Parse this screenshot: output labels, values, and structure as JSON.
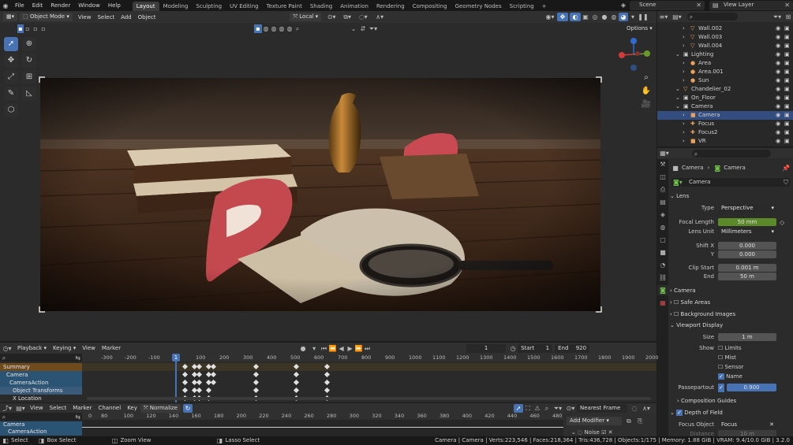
{
  "menu": [
    "File",
    "Edit",
    "Render",
    "Window",
    "Help"
  ],
  "workspaces": [
    "Layout",
    "Modeling",
    "Sculpting",
    "UV Editing",
    "Texture Paint",
    "Shading",
    "Animation",
    "Rendering",
    "Compositing",
    "Geometry Nodes",
    "Scripting"
  ],
  "add_ws": "+",
  "scene": "Scene",
  "view_layer": "View Layer",
  "vp": {
    "mode": "Object Mode",
    "view": "View",
    "select": "Select",
    "add": "Add",
    "object": "Object",
    "transform": "Local",
    "options": "Options"
  },
  "outliner": [
    {
      "name": "Wall.002",
      "indent": 2,
      "icon": "▽",
      "color": "#e8a15a"
    },
    {
      "name": "Wall.003",
      "indent": 2,
      "icon": "▽",
      "color": "#e8a15a"
    },
    {
      "name": "Wall.004",
      "indent": 2,
      "icon": "▽",
      "color": "#e8a15a"
    },
    {
      "name": "Lighting",
      "indent": 1,
      "icon": "▣",
      "color": "#cfcfcf"
    },
    {
      "name": "Area",
      "indent": 2,
      "icon": "●",
      "color": "#e8a15a"
    },
    {
      "name": "Area.001",
      "indent": 2,
      "icon": "●",
      "color": "#e8a15a"
    },
    {
      "name": "Sun",
      "indent": 2,
      "icon": "●",
      "color": "#e8a15a"
    },
    {
      "name": "Chandelier_02",
      "indent": 1,
      "icon": "▽",
      "color": "#e8a15a"
    },
    {
      "name": "On_Floor",
      "indent": 1,
      "icon": "▣",
      "color": "#cfcfcf"
    },
    {
      "name": "Camera",
      "indent": 1,
      "icon": "▣",
      "color": "#cfcfcf"
    },
    {
      "name": "Camera",
      "indent": 2,
      "icon": "■",
      "color": "#e8a15a",
      "sel": true
    },
    {
      "name": "Focus",
      "indent": 2,
      "icon": "✚",
      "color": "#e8a15a"
    },
    {
      "name": "Focus2",
      "indent": 2,
      "icon": "✚",
      "color": "#e8a15a"
    },
    {
      "name": "VR",
      "indent": 2,
      "icon": "■",
      "color": "#e8a15a"
    }
  ],
  "props": {
    "crumb1": "Camera",
    "crumb2": "Camera",
    "datablock": "Camera",
    "lens": "Lens",
    "type_label": "Type",
    "type": "Perspective",
    "focal_label": "Focal Length",
    "focal": "50 mm",
    "lens_unit_label": "Lens Unit",
    "lens_unit": "Millimeters",
    "shiftx_label": "Shift X",
    "shiftx": "0.000",
    "y_label": "Y",
    "shifty": "0.000",
    "clip_start_label": "Clip Start",
    "clip_start": "0.001 m",
    "end_label": "End",
    "clip_end": "50 m",
    "camera": "Camera",
    "safe_areas": "Safe Areas",
    "bg_images": "Background Images",
    "viewport_display": "Viewport Display",
    "size_label": "Size",
    "size": "1 m",
    "show_label": "Show",
    "limits": "Limits",
    "mist": "Mist",
    "sensor": "Sensor",
    "name": "Name",
    "passepartout_label": "Passepartout",
    "passepartout": "0.900",
    "composition": "Composition Guides",
    "dof": "Depth of Field",
    "focus_label": "Focus Object",
    "focus": "Focus",
    "distance_label": "Distance",
    "distance": "10 m"
  },
  "timeline": {
    "playback": "Playback",
    "keying": "Keying",
    "view": "View",
    "marker": "Marker",
    "frame": "1",
    "start_label": "Start",
    "start": "1",
    "end_label": "End",
    "end": "920",
    "ticks": [
      "-300",
      "-200",
      "-100",
      "1",
      "100",
      "200",
      "300",
      "400",
      "500",
      "600",
      "700",
      "800",
      "900",
      "1000",
      "1100",
      "1200",
      "1300",
      "1400",
      "1500",
      "1600",
      "1700",
      "1800",
      "1900",
      "2000"
    ],
    "channels": [
      "Summary",
      "Camera",
      "CameraAction",
      "Object Transforms",
      "X Location"
    ]
  },
  "graph": {
    "view": "View",
    "select": "Select",
    "marker": "Marker",
    "channel": "Channel",
    "key": "Key",
    "normalize": "Normalize",
    "snap": "Nearest Frame",
    "add_modifier": "Add Modifier",
    "noise": "Noise",
    "ticks": [
      "0",
      "80",
      "100",
      "120",
      "140",
      "160",
      "180",
      "200",
      "220",
      "240",
      "260",
      "280",
      "300",
      "320",
      "340",
      "360",
      "380",
      "400",
      "420",
      "440",
      "460",
      "480"
    ],
    "channels": [
      "Camera",
      "CameraAction"
    ]
  },
  "status": {
    "select": "Select",
    "box": "Box Select",
    "zoom": "Zoom View",
    "lasso": "Lasso Select",
    "info": "Camera | Camera | Verts:223,546 | Faces:218,364 | Tris:436,728 | Objects:1/175 | Memory: 1.88 GiB | VRAM: 9.4/10.0 GiB | 3.2.0"
  },
  "colors": {
    "accent": "#4772b3",
    "selected_row": "#334d80",
    "focal_green": "#5c8a2b",
    "passe_blue": "#4772b3",
    "playhead": "#4772b3",
    "summary_bg": "#6f4a1c",
    "camera_bg": "#2b5474"
  }
}
